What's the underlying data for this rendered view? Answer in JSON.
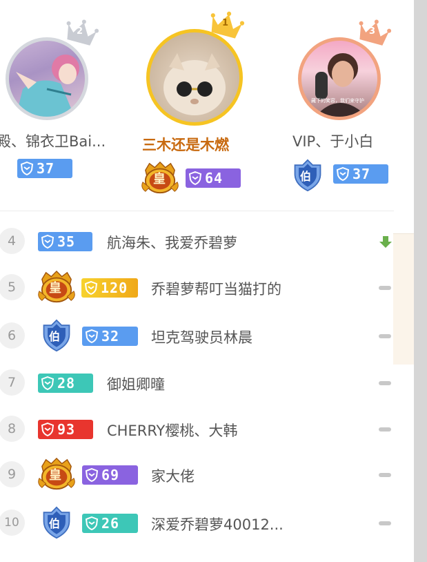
{
  "top3": [
    {
      "rank": "2",
      "name": "殿、锦衣卫Bai...",
      "fan_level": "37"
    },
    {
      "rank": "1",
      "name": "三木还是木燃",
      "fan_level": "64"
    },
    {
      "rank": "3",
      "name": "VIP、于小白",
      "fan_level": "37",
      "avatar_caption": "藏下的笑容，我们来守护"
    }
  ],
  "ranks": [
    {
      "rank": "4",
      "fan_level": "35",
      "name": "航海朱、我爱乔碧萝",
      "trend": "down"
    },
    {
      "rank": "5",
      "fan_level": "120",
      "name": "乔碧萝帮叮当猫打的",
      "trend": "flat"
    },
    {
      "rank": "6",
      "fan_level": "32",
      "name": "坦克驾驶员林晨",
      "trend": "flat"
    },
    {
      "rank": "7",
      "fan_level": "28",
      "name": "御姐卿曈",
      "trend": "flat"
    },
    {
      "rank": "8",
      "fan_level": "93",
      "name": "CHERRY樱桃、大韩",
      "trend": "flat"
    },
    {
      "rank": "9",
      "fan_level": "69",
      "name": "家大佬",
      "trend": "flat"
    },
    {
      "rank": "10",
      "fan_level": "26",
      "name": "深爱乔碧萝40012...",
      "trend": "flat"
    }
  ],
  "medals": {
    "emperor": "皇",
    "earl": "伯"
  },
  "colors": {
    "blue_badge": "#5a9cf0",
    "purple_badge": "#8a63e0",
    "teal_badge": "#3dc7b7",
    "gold_badge": "#f2b516",
    "red_badge": "#e8352e",
    "trend_down": "#6ab04c"
  }
}
